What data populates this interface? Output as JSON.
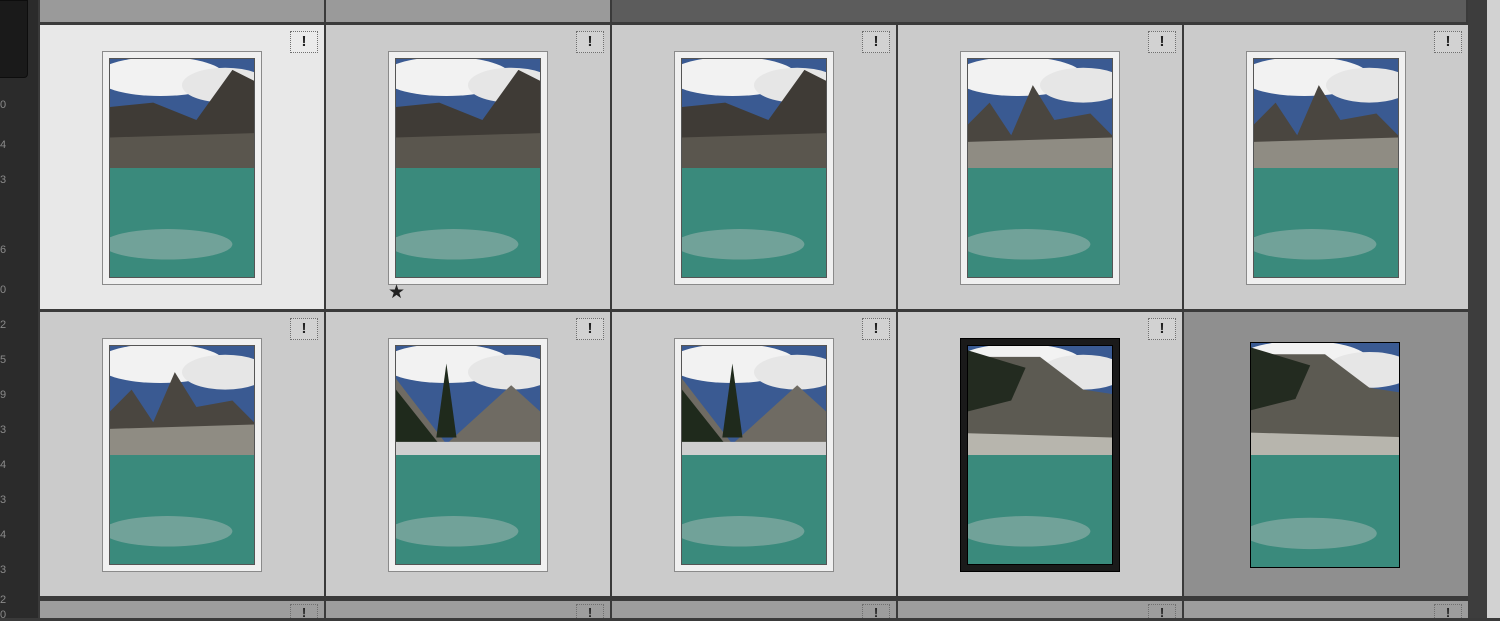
{
  "app": "photo-library-grid",
  "colors": {
    "cell_bg": "#cbcbcb",
    "cell_selected_bg": "#e8e8e8",
    "cell_dim_bg": "#8f8f8f",
    "sky": "#3a5a92",
    "cloud": "#f2f2f2",
    "rock": "#3f3b36",
    "water": "#3a8a7c"
  },
  "ruler_digits": [
    "0",
    "4",
    "3",
    "6",
    "0",
    "2",
    "5",
    "9",
    "3",
    "4",
    "3",
    "4",
    "3",
    "2",
    "0"
  ],
  "badge_icon_label": "!",
  "rows": [
    {
      "cells": [
        {
          "bg_number": "",
          "badge": "!",
          "state": "selected",
          "frame": "light",
          "scene": "peak",
          "star": ""
        },
        {
          "bg_number": "",
          "badge": "!",
          "state": "normal",
          "frame": "light",
          "scene": "peak",
          "star": "★"
        },
        {
          "bg_number": "",
          "badge": "!",
          "state": "normal",
          "frame": "light",
          "scene": "peak",
          "star": ""
        },
        {
          "bg_number": "",
          "badge": "!",
          "state": "normal",
          "frame": "light",
          "scene": "spire",
          "star": ""
        },
        {
          "bg_number": "",
          "badge": "!",
          "state": "normal",
          "frame": "light",
          "scene": "spire",
          "star": ""
        }
      ]
    },
    {
      "cells": [
        {
          "bg_number": "",
          "badge": "!",
          "state": "normal",
          "frame": "light",
          "scene": "spire",
          "star": ""
        },
        {
          "bg_number": "",
          "badge": "!",
          "state": "normal",
          "frame": "light",
          "scene": "trees",
          "star": ""
        },
        {
          "bg_number": "",
          "badge": "!",
          "state": "normal",
          "frame": "light",
          "scene": "trees",
          "star": ""
        },
        {
          "bg_number": "",
          "badge": "!",
          "state": "normal",
          "frame": "dark",
          "scene": "cliff",
          "star": ""
        },
        {
          "bg_number": "",
          "badge": "",
          "state": "dim",
          "frame": "none",
          "scene": "cliff",
          "star": ""
        }
      ]
    }
  ]
}
